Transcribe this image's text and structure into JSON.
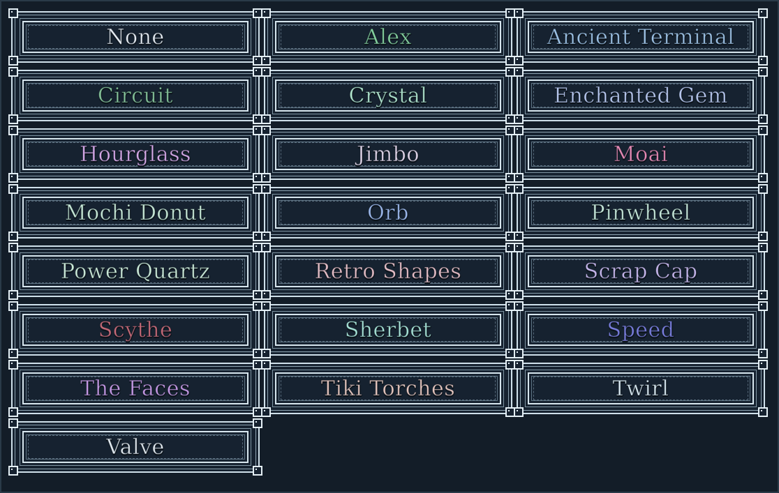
{
  "options": [
    {
      "label": "None",
      "color": "#e8eef5"
    },
    {
      "label": "Alex",
      "color": "#86d4a0"
    },
    {
      "label": "Ancient Terminal",
      "color": "#9fc4e8"
    },
    {
      "label": "Circuit",
      "color": "#86c49a"
    },
    {
      "label": "Crystal",
      "color": "#b2e8d0"
    },
    {
      "label": "Enchanted Gem",
      "color": "#b8c8f0"
    },
    {
      "label": "Hourglass",
      "color": "#d6a8e8"
    },
    {
      "label": "Jimbo",
      "color": "#e4d8ec"
    },
    {
      "label": "Moai",
      "color": "#e88ab6"
    },
    {
      "label": "Mochi Donut",
      "color": "#c8ead8"
    },
    {
      "label": "Orb",
      "color": "#9cb8ec"
    },
    {
      "label": "Pinwheel",
      "color": "#c8eadc"
    },
    {
      "label": "Power Quartz",
      "color": "#cdecda"
    },
    {
      "label": "Retro Shapes",
      "color": "#e8c0c8"
    },
    {
      "label": "Scrap Cap",
      "color": "#c8b8ee"
    },
    {
      "label": "Scythe",
      "color": "#c86a78"
    },
    {
      "label": "Sherbet",
      "color": "#a8e4d8"
    },
    {
      "label": "Speed",
      "color": "#7a7ee0"
    },
    {
      "label": "The Faces",
      "color": "#c89ae8"
    },
    {
      "label": "Tiki Torches",
      "color": "#e8c8c0"
    },
    {
      "label": "Twirl",
      "color": "#dcecf4"
    },
    {
      "label": "Valve",
      "color": "#e4ecf2"
    }
  ]
}
